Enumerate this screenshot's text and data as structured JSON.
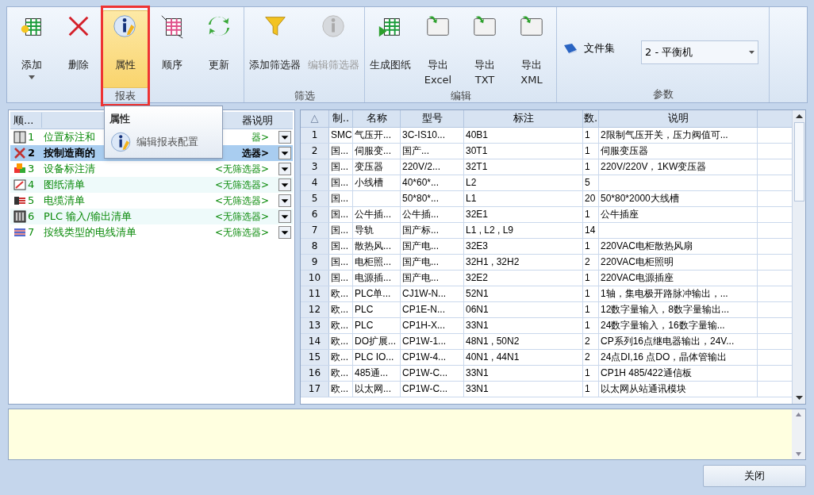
{
  "ribbon": {
    "groups": [
      {
        "label": "报表",
        "buttons": [
          {
            "label": "添加",
            "dropdown": true,
            "selected": false,
            "disabled": false
          },
          {
            "label": "删除",
            "selected": false,
            "disabled": false
          },
          {
            "label": "属性",
            "selected": true,
            "disabled": false
          },
          {
            "label": "顺序",
            "selected": false,
            "disabled": false
          },
          {
            "label": "更新",
            "selected": false,
            "disabled": false
          }
        ]
      },
      {
        "label": "筛选",
        "buttons": [
          {
            "label": "添加筛选器",
            "selected": false,
            "disabled": false
          },
          {
            "label": "编辑筛选器",
            "selected": false,
            "disabled": true
          }
        ]
      },
      {
        "label": "编辑",
        "buttons": [
          {
            "label": "生成图纸",
            "selected": false,
            "disabled": false
          },
          {
            "label": "导出\nExcel",
            "selected": false,
            "disabled": false
          },
          {
            "label": "导出\nTXT",
            "selected": false,
            "disabled": false
          },
          {
            "label": "导出\nXML",
            "selected": false,
            "disabled": false
          }
        ]
      }
    ],
    "params": {
      "label": "参数",
      "file_set_label": "文件集",
      "file_set_value": "2 - 平衡机"
    }
  },
  "popup": {
    "title": "属性",
    "item": "编辑报表配置"
  },
  "reports": {
    "columns": [
      "顺...",
      "器说明"
    ],
    "rows": [
      {
        "number": "1",
        "name": "位置标注和",
        "filter": "器>",
        "selected": false
      },
      {
        "number": "2",
        "name": "按制造商的",
        "filter": "选器>",
        "selected": true
      },
      {
        "number": "3",
        "name": "设备标注清",
        "filter": "<无筛选器>",
        "selected": false
      },
      {
        "number": "4",
        "name": "图纸清单",
        "filter": "<无筛选器>",
        "selected": false
      },
      {
        "number": "5",
        "name": "电缆清单",
        "filter": "<无筛选器>",
        "selected": false
      },
      {
        "number": "6",
        "name": "PLC 输入/输出清单",
        "filter": "<无筛选器>",
        "selected": false
      },
      {
        "number": "7",
        "name": "按线类型的电线清单",
        "filter": "<无筛选器>",
        "selected": false
      }
    ]
  },
  "table": {
    "sort_indicator": "△",
    "columns": [
      "制..",
      "名称",
      "型号",
      "标注",
      "数.",
      "说明"
    ],
    "rows": [
      {
        "n": "1",
        "cells": [
          "SMC",
          "气压开...",
          "3C-IS10...",
          "40B1",
          "1",
          "2限制气压开关，压力阀值可..."
        ]
      },
      {
        "n": "2",
        "cells": [
          "国...",
          "伺服变...",
          "国产...",
          "30T1",
          "1",
          "伺服变压器"
        ]
      },
      {
        "n": "3",
        "cells": [
          "国...",
          "变压器",
          "220V/2...",
          "32T1",
          "1",
          "220V/220V，1KW变压器"
        ]
      },
      {
        "n": "4",
        "cells": [
          "国...",
          "小线槽",
          "40*60*...",
          "L2",
          "5",
          ""
        ]
      },
      {
        "n": "5",
        "cells": [
          "国...",
          "",
          "50*80*...",
          "L1",
          "20",
          "50*80*2000大线槽"
        ]
      },
      {
        "n": "6",
        "cells": [
          "国...",
          "公牛插...",
          "公牛插...",
          "32E1",
          "1",
          "公牛插座"
        ]
      },
      {
        "n": "7",
        "cells": [
          "国...",
          "导轨",
          "国产标...",
          "L1 , L2 , L9",
          "14",
          ""
        ]
      },
      {
        "n": "8",
        "cells": [
          "国...",
          "散热风...",
          "国产电...",
          "32E3",
          "1",
          "220VAC电柜散热风扇"
        ]
      },
      {
        "n": "9",
        "cells": [
          "国...",
          "电柜照...",
          "国产电...",
          "32H1 , 32H2",
          "2",
          "220VAC电柜照明"
        ]
      },
      {
        "n": "10",
        "cells": [
          "国...",
          "电源插...",
          "国产电...",
          "32E2",
          "1",
          "220VAC电源插座"
        ]
      },
      {
        "n": "11",
        "cells": [
          "欧...",
          "PLC单...",
          "CJ1W-N...",
          "52N1",
          "1",
          "1轴，集电极开路脉冲输出，..."
        ]
      },
      {
        "n": "12",
        "cells": [
          "欧...",
          "PLC",
          "CP1E-N...",
          "06N1",
          "1",
          "12数字量输入，8数字量输出..."
        ]
      },
      {
        "n": "13",
        "cells": [
          "欧...",
          "PLC",
          "CP1H-X...",
          "33N1",
          "1",
          "24数字量输入，16数字量输..."
        ]
      },
      {
        "n": "14",
        "cells": [
          "欧...",
          "DO扩展...",
          "CP1W-1...",
          "48N1 , 50N2",
          "2",
          "CP系列16点继电器输出，24V..."
        ]
      },
      {
        "n": "15",
        "cells": [
          "欧...",
          "PLC  IO...",
          "CP1W-4...",
          "40N1 , 44N1",
          "2",
          "24点DI,16 点DO，晶体管输出"
        ]
      },
      {
        "n": "16",
        "cells": [
          "欧...",
          "485通...",
          "CP1W-C...",
          "33N1",
          "1",
          "CP1H 485/422通信板"
        ]
      },
      {
        "n": "17",
        "cells": [
          "欧...",
          "以太网...",
          "CP1W-C...",
          "33N1",
          "1",
          "以太网从站通讯模块"
        ]
      }
    ]
  },
  "close_button": "关闭"
}
